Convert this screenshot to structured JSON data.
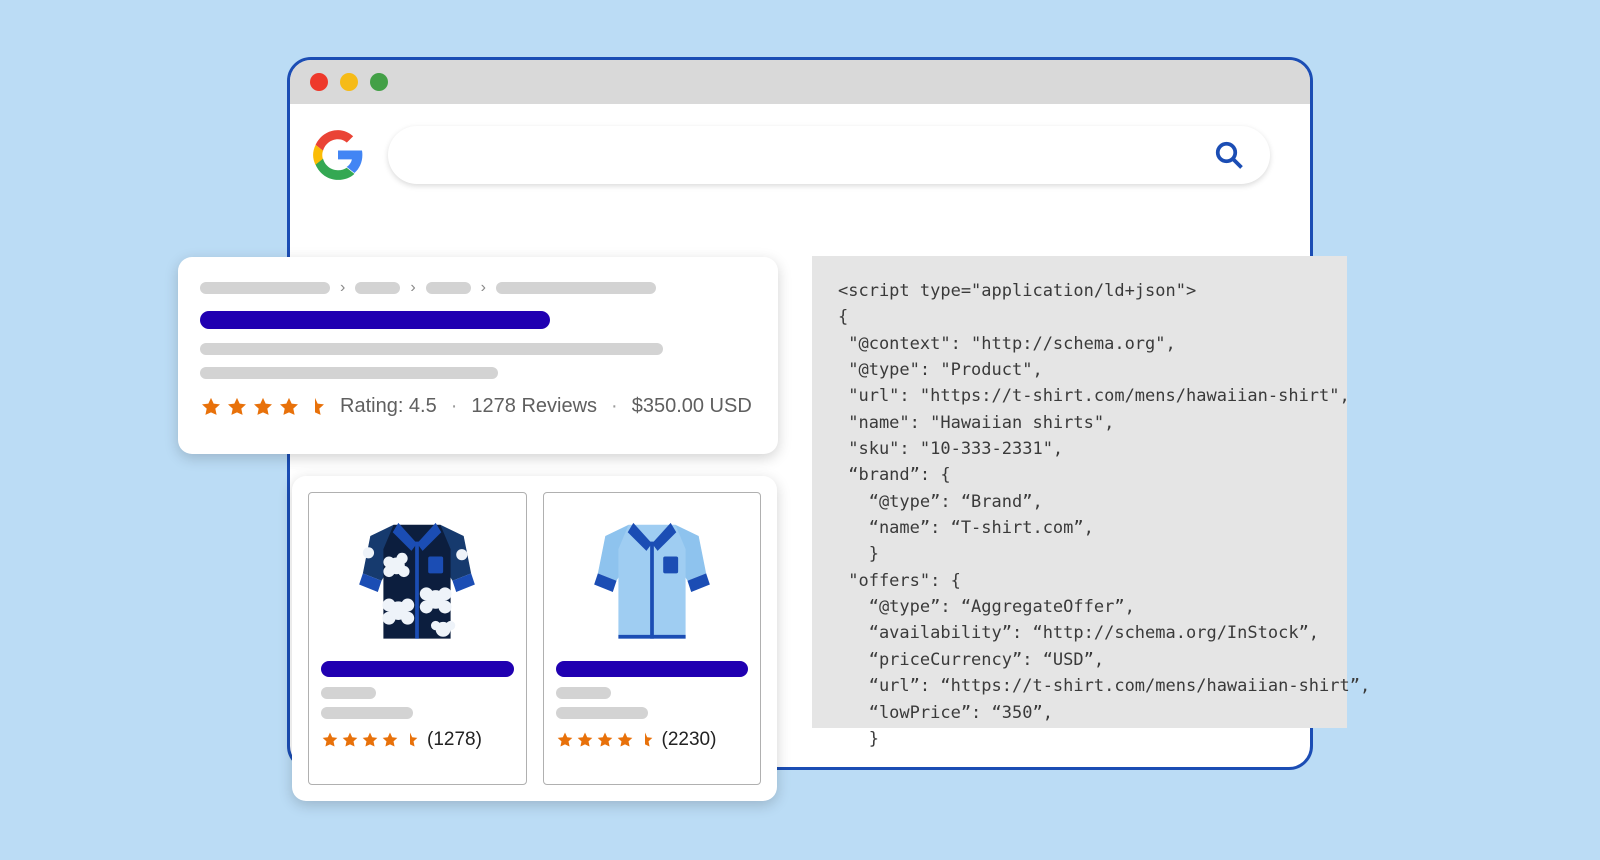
{
  "colors": {
    "page_bg": "#bbdcf5",
    "browser_border": "#1b4db4",
    "titlebar": "#d9d9d9",
    "titlebar_red": "#ee392b",
    "titlebar_yellow": "#f6bb17",
    "titlebar_green": "#43a047",
    "skeleton": "#d3d3d3",
    "title_bar_blue": "#2000b1",
    "star": "#e8710a",
    "text_muted": "#5f5f5f",
    "code_bg": "#e5e5e5",
    "logo_red": "#ea4335",
    "logo_yellow": "#fbbc05",
    "logo_green": "#34a853",
    "logo_blue": "#4285f4"
  },
  "search": {
    "query": "",
    "placeholder": ""
  },
  "result": {
    "rating_label": "Rating: 4.5",
    "reviews_label": "1278 Reviews",
    "price_label": "$350.00 USD",
    "star_count": 4.5,
    "separator": "·"
  },
  "products": [
    {
      "name": "hawaiian-shirt-dark",
      "star_count": 4.5,
      "count_label": "(1278)"
    },
    {
      "name": "hawaiian-shirt-light",
      "star_count": 4.5,
      "count_label": "(2230)"
    }
  ],
  "code": {
    "lines": [
      "<script type=\"application/ld+json\">",
      "{",
      " \"@context\": \"http://schema.org\",",
      " \"@type\": \"Product\",",
      " \"url\": \"https://t-shirt.com/mens/hawaiian-shirt\",",
      " \"name\": \"Hawaiian shirts\",",
      " \"sku\": \"10-333-2331\",",
      " “brand”: {",
      "   “@type”: “Brand”,",
      "   “name”: “T-shirt.com”,",
      "   }",
      " \"offers\": {",
      "   “@type”: “AggregateOffer”,",
      "   “availability”: “http://schema.org/InStock”,",
      "   “priceCurrency”: “USD”,",
      "   “url”: “https://t-shirt.com/mens/hawaiian-shirt”,",
      "   “lowPrice”: “350”,",
      "   }"
    ]
  }
}
